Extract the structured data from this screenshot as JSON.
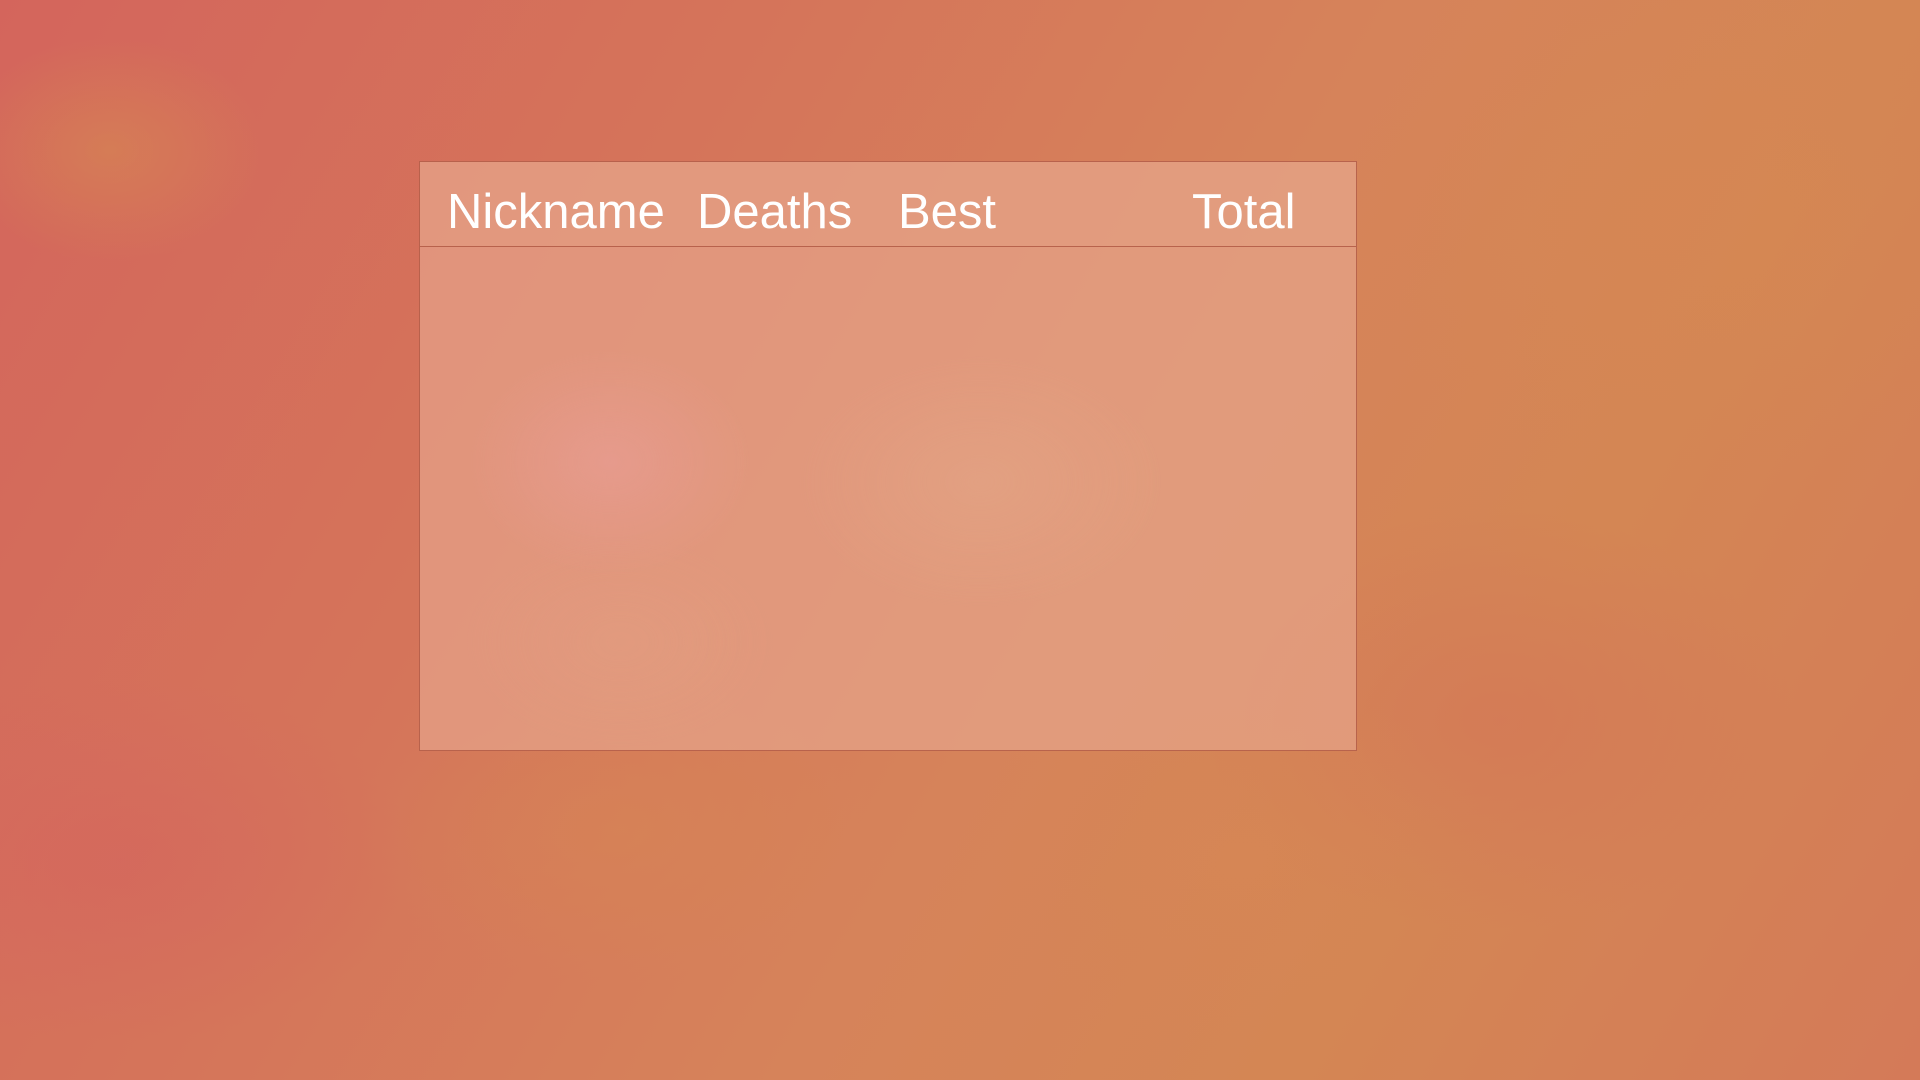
{
  "scoreboard": {
    "columns": {
      "nickname": "Nickname",
      "deaths": "Deaths",
      "best": "Best",
      "total": "Total"
    },
    "rows": []
  },
  "colors": {
    "background_top_right": "#d48654",
    "background_bottom_left": "#d4655c",
    "panel_fill": "#e8aa92",
    "header_text": "#ffffff",
    "border": "#aa503c"
  }
}
